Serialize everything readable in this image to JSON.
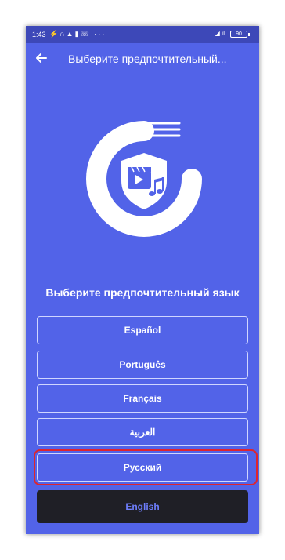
{
  "status_bar": {
    "time": "1:43",
    "left_icons": "⚡∩▲▮☏ ···",
    "signal": "◢.ıl",
    "battery": "90"
  },
  "app_bar": {
    "title": "Выберите предпочтительный..."
  },
  "heading": "Выберите предпочтительный язык",
  "languages": [
    {
      "label": "Español"
    },
    {
      "label": "Português"
    },
    {
      "label": "Français"
    },
    {
      "label": "العربية"
    },
    {
      "label": "Русский",
      "highlighted": true
    },
    {
      "label": "English",
      "selected": true
    }
  ],
  "colors": {
    "background": "#5263e8",
    "status_bar": "#3d48b8",
    "highlight": "#e0242c",
    "selected_bg": "#1f1f26",
    "selected_text": "#6f7fff"
  },
  "icons": {
    "back": "arrow-left-icon",
    "logo": "app-logo-icon"
  }
}
